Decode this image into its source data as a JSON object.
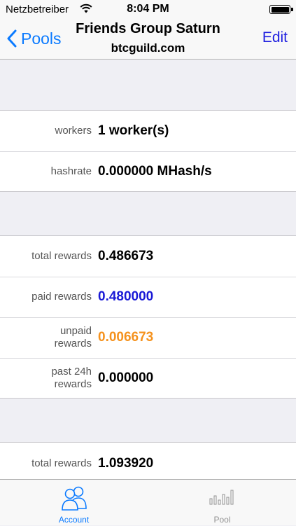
{
  "status_bar": {
    "carrier": "Netzbetreiber",
    "time": "8:04 PM"
  },
  "nav": {
    "back_label": "Pools",
    "title": "Friends Group Saturn",
    "subtitle": "btcguild.com",
    "edit_label": "Edit"
  },
  "workers_section": {
    "rows": [
      {
        "label": "workers",
        "value": "1 worker(s)"
      },
      {
        "label": "hashrate",
        "value": "0.000000 MHash/s"
      }
    ]
  },
  "rewards_section": {
    "rows": [
      {
        "label": "total rewards",
        "value": "0.486673",
        "color": "#000000"
      },
      {
        "label": "paid rewards",
        "value": "0.480000",
        "color": "#1a1ad6"
      },
      {
        "label": "unpaid rewards",
        "value": "0.006673",
        "color": "#f5921e"
      },
      {
        "label": "past 24h rewards",
        "value": "0.000000",
        "color": "#000000"
      }
    ]
  },
  "pool_section": {
    "rows": [
      {
        "label": "total rewards",
        "value": "1.093920"
      }
    ]
  },
  "tab_bar": {
    "tabs": [
      {
        "label": "Account",
        "icon": "account-icon",
        "selected": true
      },
      {
        "label": "Pool",
        "icon": "pool-chart-icon",
        "selected": false
      }
    ]
  },
  "colors": {
    "accent": "#0a7aff",
    "edit": "#2020e0",
    "paid": "#1a1ad6",
    "unpaid": "#f5921e",
    "inactive_tab": "#929292"
  }
}
